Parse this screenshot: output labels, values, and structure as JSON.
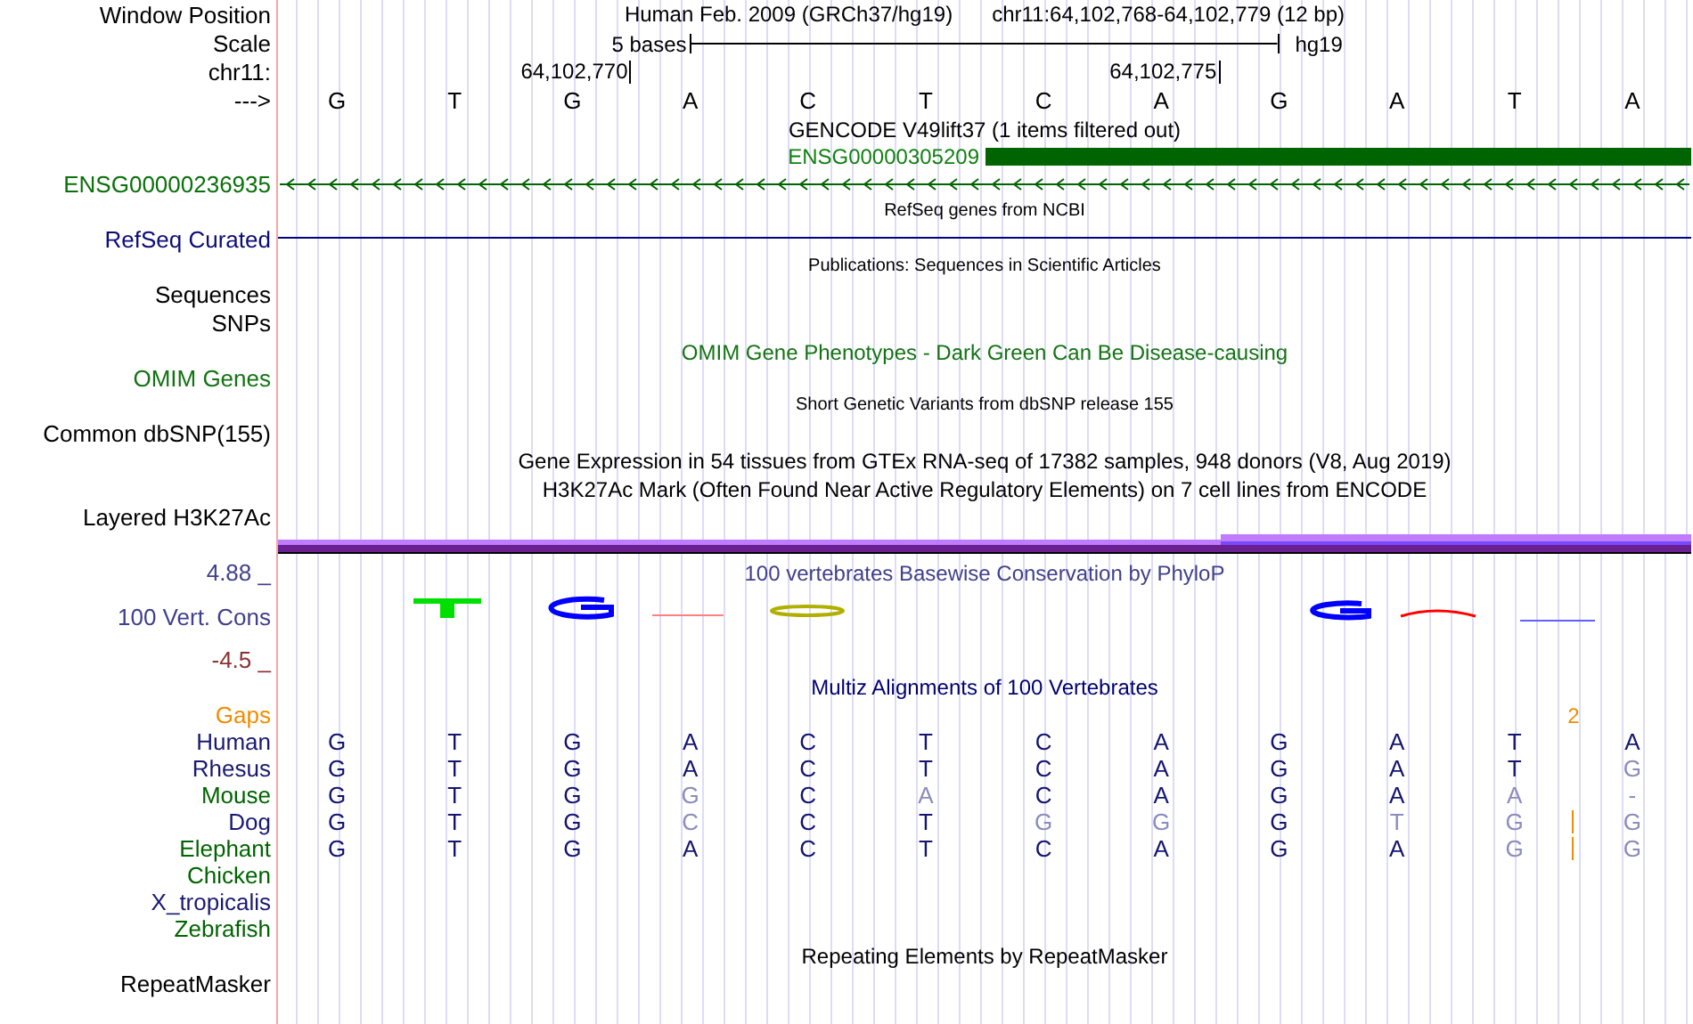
{
  "position": {
    "label": "Window Position",
    "assembly_text": "Human Feb. 2009 (GRCh37/hg19)",
    "range_text": "chr11:64,102,768-64,102,779 (12 bp)"
  },
  "scale": {
    "label": "Scale",
    "bar_label": "5 bases",
    "assembly": "hg19"
  },
  "ruler": {
    "label": "chr11:"
  },
  "sequence": {
    "label": "--->",
    "bases": [
      {
        "base": "G"
      },
      {
        "base": "T"
      },
      {
        "base": "G",
        "tick_label": "64,102,770"
      },
      {
        "base": "A"
      },
      {
        "base": "C"
      },
      {
        "base": "T"
      },
      {
        "base": "C"
      },
      {
        "base": "A",
        "tick_label": "64,102,775"
      },
      {
        "base": "G"
      },
      {
        "base": "A"
      },
      {
        "base": "T"
      },
      {
        "base": "A"
      }
    ]
  },
  "gencode": {
    "title": "GENCODE V49lift37 (1 items filtered out)",
    "feature": "ENSG00000305209",
    "gene_label": "ENSG00000236935"
  },
  "refseq": {
    "title": "RefSeq genes from NCBI",
    "label": "RefSeq Curated"
  },
  "publications": {
    "title": "Publications: Sequences in Scientific Articles",
    "label_lines": [
      "Sequences",
      "SNPs"
    ]
  },
  "omim": {
    "title": "OMIM Gene Phenotypes - Dark Green Can Be Disease-causing",
    "label": "OMIM Genes"
  },
  "dbsnp": {
    "title": "Short Genetic Variants from dbSNP release 155",
    "label": "Common dbSNP(155)"
  },
  "gtex": {
    "title": "Gene Expression in 54 tissues from GTEx RNA-seq of 17382 samples, 948 donors (V8, Aug 2019)"
  },
  "h3k27ac": {
    "title": "H3K27Ac Mark (Often Found Near Active Regulatory Elements) on 7 cell lines from ENCODE",
    "label": "Layered H3K27Ac"
  },
  "phylop": {
    "title": "100 vertebrates Basewise Conservation by PhyloP",
    "label": "100 Vert. Cons",
    "max_label": "4.88 _",
    "min_label": "-4.5 _"
  },
  "multiz": {
    "title": "Multiz Alignments of 100 Vertebrates",
    "gaps": {
      "label": "Gaps",
      "count": "2"
    },
    "species": [
      {
        "name": "Human",
        "color": "#191970",
        "bases": [
          "G",
          "T",
          "G",
          "A",
          "C",
          "T",
          "C",
          "A",
          "G",
          "A",
          "T",
          "A"
        ],
        "differs": [
          false,
          false,
          false,
          false,
          false,
          false,
          false,
          false,
          false,
          false,
          false,
          false
        ]
      },
      {
        "name": "Rhesus",
        "color": "#191970",
        "bases": [
          "G",
          "T",
          "G",
          "A",
          "C",
          "T",
          "C",
          "A",
          "G",
          "A",
          "T",
          "G"
        ],
        "differs": [
          false,
          false,
          false,
          false,
          false,
          false,
          false,
          false,
          false,
          false,
          false,
          true
        ]
      },
      {
        "name": "Mouse",
        "color": "#006400",
        "bases": [
          "G",
          "T",
          "G",
          "G",
          "C",
          "A",
          "C",
          "A",
          "G",
          "A",
          "A",
          "-"
        ],
        "differs": [
          false,
          false,
          false,
          true,
          false,
          true,
          false,
          false,
          false,
          false,
          true,
          true
        ]
      },
      {
        "name": "Dog",
        "color": "#191970",
        "bases": [
          "G",
          "T",
          "G",
          "C",
          "C",
          "T",
          "G",
          "G",
          "G",
          "T",
          "G",
          "G"
        ],
        "differs": [
          false,
          false,
          false,
          true,
          false,
          false,
          true,
          true,
          false,
          true,
          true,
          true
        ],
        "insertion": true
      },
      {
        "name": "Elephant",
        "color": "#006400",
        "bases": [
          "G",
          "T",
          "G",
          "A",
          "C",
          "T",
          "C",
          "A",
          "G",
          "A",
          "G",
          "G"
        ],
        "differs": [
          false,
          false,
          false,
          false,
          false,
          false,
          false,
          false,
          false,
          false,
          true,
          true
        ],
        "insertion": true
      },
      {
        "name": "Chicken",
        "color": "#006400"
      },
      {
        "name": "X_tropicalis",
        "color": "#191970"
      },
      {
        "name": "Zebrafish",
        "color": "#006400"
      }
    ]
  },
  "repeatmasker": {
    "title": "Repeating Elements by RepeatMasker",
    "label": "RepeatMasker"
  }
}
